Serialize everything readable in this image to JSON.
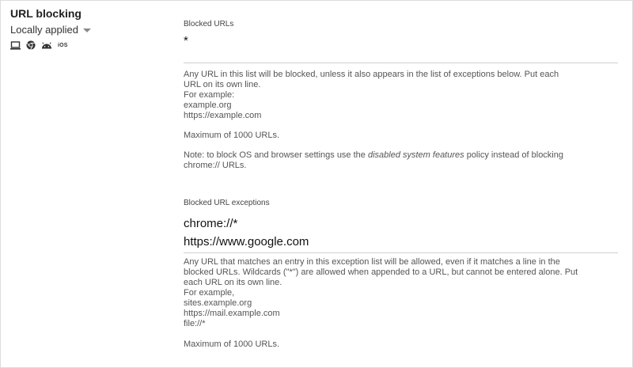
{
  "policy": {
    "title": "URL blocking",
    "status": "Locally applied",
    "platform_icons": [
      "laptop-icon",
      "chrome-icon",
      "android-icon",
      "ios-icon"
    ],
    "ios_label": "iOS"
  },
  "blocked_urls": {
    "label": "Blocked URLs",
    "value": "*",
    "help_line1": "Any URL in this list will be blocked, unless it also appears in the list of exceptions below. Put each URL on its own line.",
    "help_example_heading": "For example:",
    "help_examples": [
      "example.org",
      "https://example.com"
    ],
    "max_text": "Maximum of 1000 URLs.",
    "note_prefix": "Note: to block OS and browser settings use the ",
    "note_emphasis": "disabled system features",
    "note_suffix": " policy instead of blocking chrome:// URLs."
  },
  "exceptions": {
    "label": "Blocked URL exceptions",
    "values": [
      "chrome://*",
      "https://www.google.com"
    ],
    "help_line1": "Any URL that matches an entry in this exception list will be allowed, even if it matches a line in the blocked URLs. Wildcards (\"*\") are allowed when appended to a URL, but cannot be entered alone. Put each URL on its own line.",
    "help_example_heading": "For example,",
    "help_examples": [
      "sites.example.org",
      "https://mail.example.com",
      "file://*"
    ],
    "max_text": "Maximum of 1000 URLs."
  },
  "colors": {
    "text": "#212121",
    "muted": "#555555",
    "divider": "#cfcfcf"
  }
}
